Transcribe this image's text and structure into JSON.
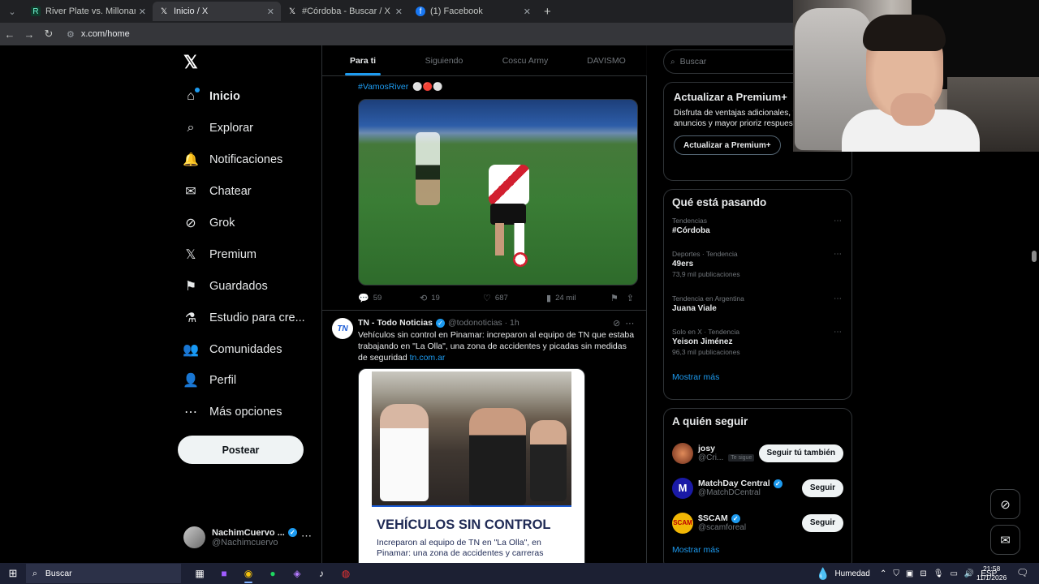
{
  "browser": {
    "tabs": [
      {
        "label": "River Plate vs. Millonarios | Disney+",
        "favicon": "R"
      },
      {
        "label": "Inicio / X",
        "favicon": "𝕏"
      },
      {
        "label": "#Córdoba - Buscar / X",
        "favicon": "𝕏"
      },
      {
        "label": "(1) Facebook",
        "favicon": "f"
      }
    ],
    "url": "x.com/home"
  },
  "sidebar": {
    "items": [
      {
        "label": "Inicio",
        "icon": "⌂"
      },
      {
        "label": "Explorar",
        "icon": "⌕"
      },
      {
        "label": "Notificaciones",
        "icon": "🔔"
      },
      {
        "label": "Chatear",
        "icon": "✉"
      },
      {
        "label": "Grok",
        "icon": "⊘"
      },
      {
        "label": "Premium",
        "icon": "𝕏"
      },
      {
        "label": "Guardados",
        "icon": "⚑"
      },
      {
        "label": "Estudio para cre...",
        "icon": "⚗"
      },
      {
        "label": "Comunidades",
        "icon": "👥"
      },
      {
        "label": "Perfil",
        "icon": "👤"
      },
      {
        "label": "Más opciones",
        "icon": "⋯"
      }
    ],
    "post_label": "Postear",
    "account": {
      "name": "NachimCuervo ...",
      "handle": "@Nachimcuervo"
    }
  },
  "feed": {
    "tabs": [
      "Para ti",
      "Siguiendo",
      "Coscu Army",
      "DAVISMO"
    ],
    "post1": {
      "hashtag": "#VamosRiver",
      "replies": "59",
      "reposts": "19",
      "likes": "687",
      "views": "24 mil"
    },
    "post2": {
      "avatar_text": "TN",
      "name": "TN - Todo Noticias",
      "handle": "@todonoticias · 1h",
      "text": "Vehículos sin control en Pinamar: increparon al equipo de TN que estaba trabajando en \"La Olla\", una zona de accidentes y picadas sin medidas de seguridad",
      "link": "tn.com.ar",
      "image_headline": "VEHÍCULOS SIN CONTROL",
      "image_sub": "Increparon al equipo de TN en \"La Olla\", en Pinamar: una zona de accidentes y carreras"
    }
  },
  "right": {
    "search_placeholder": "Buscar",
    "premium": {
      "title": "Actualizar a Premium+",
      "text": "Disfruta de ventajas adicionales, total de anuncios y mayor prioriz respuestas.",
      "button": "Actualizar a Premium+"
    },
    "trends": {
      "title": "Qué está pasando",
      "items": [
        {
          "context": "Tendencias",
          "name": "#Córdoba",
          "count": ""
        },
        {
          "context": "Deportes · Tendencia",
          "name": "49ers",
          "count": "73,9 mil publicaciones"
        },
        {
          "context": "Tendencia en Argentina",
          "name": "Juana Viale",
          "count": ""
        },
        {
          "context": "Solo en X · Tendencia",
          "name": "Yeison Jiménez",
          "count": "96,3 mil publicaciones"
        }
      ],
      "show_more": "Mostrar más"
    },
    "follow": {
      "title": "A quién seguir",
      "users": [
        {
          "name": "josy",
          "handle": "@Cri...",
          "tag": "Te sigue",
          "button": "Seguir tú también",
          "color": "#b5543a"
        },
        {
          "name": "MatchDay Central",
          "handle": "@MatchDCentral",
          "tag": "",
          "button": "Seguir",
          "color": "#1a1aa6"
        },
        {
          "name": "$SCAM",
          "handle": "@scamforeal",
          "tag": "",
          "button": "Seguir",
          "color": "#f2b705"
        }
      ],
      "show_more": "Mostrar más"
    }
  },
  "taskbar": {
    "search": "Buscar",
    "weather": "Humedad",
    "lang": "ESP",
    "time": "21:58",
    "date": "11/1/2026"
  }
}
